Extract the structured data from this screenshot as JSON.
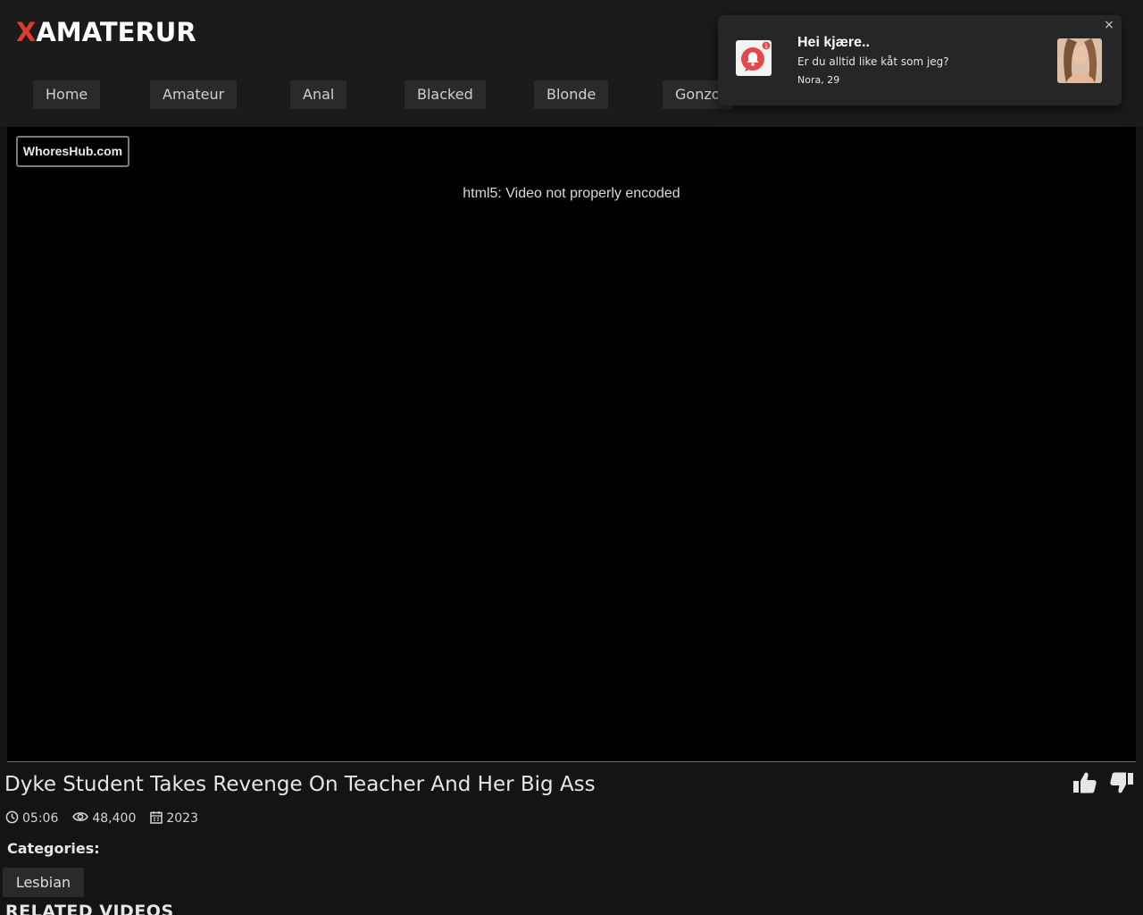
{
  "logo": {
    "x": "X",
    "rest": "AMATERUR",
    "accent_color": "#e03a2f"
  },
  "nav": {
    "items": [
      {
        "label": "Home"
      },
      {
        "label": "Amateur"
      },
      {
        "label": "Anal"
      },
      {
        "label": "Blacked"
      },
      {
        "label": "Blonde"
      },
      {
        "label": "Gonzo"
      }
    ]
  },
  "player": {
    "watermark": "WhoresHub.com",
    "error": "html5: Video not properly encoded"
  },
  "video": {
    "title": "Dyke Student Takes Revenge On Teacher And Her Big Ass",
    "duration": "05:06",
    "views": "48,400",
    "year": "2023",
    "categories_label": "Categories:",
    "categories": [
      "Lesbian"
    ]
  },
  "related_title": "RELATED VIDEOS",
  "popup": {
    "title": "Hei kjære..",
    "message": "Er du alltid like kåt som jeg?",
    "name": "Nora, 29",
    "close": "×",
    "icon": "chat-notification-icon",
    "badge": "1"
  },
  "icons": {
    "like": "thumbs-up-icon",
    "dislike": "thumbs-down-icon",
    "duration": "clock-icon",
    "views": "eye-icon",
    "year": "calendar-icon"
  }
}
